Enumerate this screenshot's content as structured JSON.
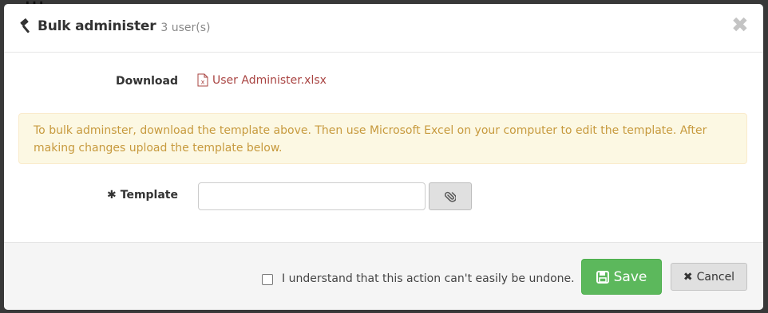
{
  "modal": {
    "title": "Bulk administer",
    "subtitle": "3 user(s)",
    "close_symbol": "✖"
  },
  "download": {
    "label": "Download",
    "file_name": "User Administer.xlsx",
    "icon": "excel-file-icon"
  },
  "alert": {
    "text": "To bulk adminster, download the template above. Then use Microsoft Excel on your computer to edit the template. After making changes upload the template below."
  },
  "template_field": {
    "required_marker": "✱",
    "label": "Template",
    "value": "",
    "attach_icon": "paperclip-icon"
  },
  "footer": {
    "confirm_label": "I understand that this action can't easily be undone.",
    "confirm_checked": false,
    "save_label": "Save",
    "cancel_symbol": "✖",
    "cancel_label": "Cancel"
  },
  "colors": {
    "save_bg": "#5cb85c",
    "link": "#a94442",
    "alert_bg": "#fcf8e3",
    "alert_text": "#c79a3e"
  }
}
